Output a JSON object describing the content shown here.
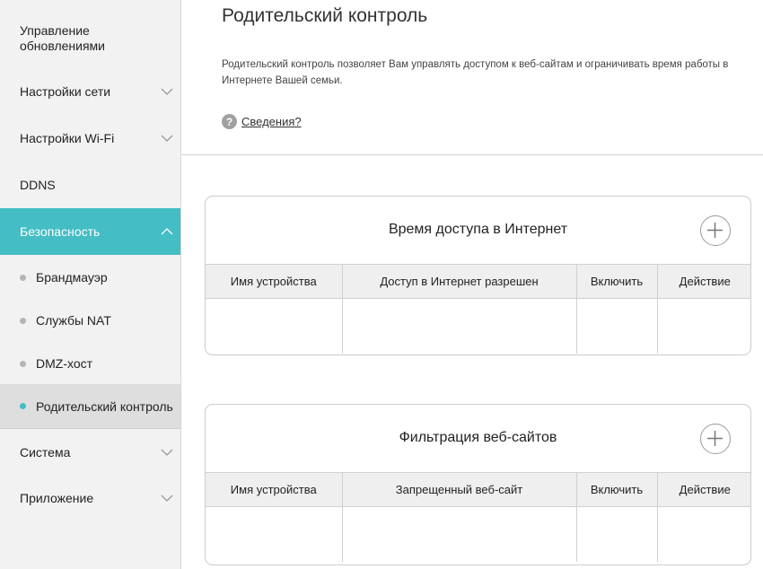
{
  "sidebar": {
    "items": [
      {
        "label": "Управление\nобновлениями",
        "line1": "Управление",
        "line2": "обновлениями"
      },
      {
        "label": "Настройки сети"
      },
      {
        "label": "Настройки Wi-Fi"
      },
      {
        "label": "DDNS"
      },
      {
        "label": "Безопасность"
      },
      {
        "label": "Система"
      },
      {
        "label": "Приложение"
      }
    ],
    "security_subitems": [
      {
        "label": "Брандмауэр"
      },
      {
        "label": "Службы NAT"
      },
      {
        "label": "DMZ-хост"
      },
      {
        "label": "Родительский контроль"
      }
    ],
    "icons": {
      "collapsed": "chevron-down-icon",
      "expanded": "chevron-up-icon",
      "bullet": "dot-icon"
    },
    "colors": {
      "active_bg": "#45bdc4",
      "selected_bg": "#dedede",
      "sidebar_bg": "#f2f2f2"
    }
  },
  "main": {
    "title": "Родительский контроль",
    "description": "Родительский контроль позволяет Вам управлять доступом к веб-сайтам и ограничивать время работы в Интернете Вашей семьи.",
    "help_link": "Сведения?",
    "help_icon": "question-circle-icon",
    "panels": [
      {
        "title": "Время доступа в Интернет",
        "add_icon": "plus-circle-icon",
        "columns": [
          "Имя устройства",
          "Доступ в Интернет разрешен",
          "Включить",
          "Действие"
        ]
      },
      {
        "title": "Фильтрация веб-сайтов",
        "add_icon": "plus-circle-icon",
        "columns": [
          "Имя устройства",
          "Запрещенный веб-сайт",
          "Включить",
          "Действие"
        ]
      }
    ]
  }
}
